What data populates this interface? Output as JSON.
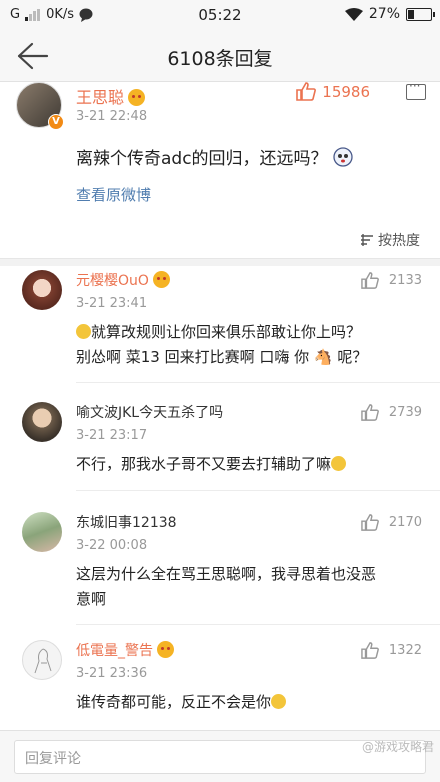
{
  "status_bar": {
    "carrier": "G",
    "speed": "0K/s",
    "time": "05:22",
    "battery_percent": "27%",
    "battery_level": 0.27
  },
  "header": {
    "title": "6108条回复"
  },
  "main_post": {
    "username": "王思聪",
    "likes": "15986",
    "timestamp": "3-21 22:48",
    "text": "离辣个传奇adc的回归，还远吗？",
    "view_original": "查看原微博",
    "sort_label": "按热度"
  },
  "replies": [
    {
      "username": "元樱樱OuO",
      "timestamp": "3-21 23:41",
      "likes": "2133",
      "lines": [
        "就算改规则让你回来俱乐部敢让你上吗？",
        "别怂啊 菜13 回来打比赛啊 口嗨 你 🐴 呢？"
      ],
      "name_color": "#eb7350"
    },
    {
      "username": "喻文波JKL今天五杀了吗",
      "timestamp": "3-21 23:17",
      "likes": "2739",
      "lines": [
        "不行，那我水子哥不又要去打辅助了嘛"
      ],
      "name_color": "#333333"
    },
    {
      "username": "东城旧事12138",
      "timestamp": "3-22 00:08",
      "likes": "2170",
      "lines": [
        "这层为什么全在骂王思聪啊，我寻思着也没恶",
        "意啊"
      ],
      "name_color": "#333333"
    },
    {
      "username": "低電量_警告",
      "timestamp": "3-21 23:36",
      "likes": "1322",
      "lines": [
        "谁传奇都可能，反正不会是你"
      ],
      "name_color": "#eb7350"
    }
  ],
  "input": {
    "placeholder": "回复评论"
  },
  "watermark": "@游戏攻略君"
}
